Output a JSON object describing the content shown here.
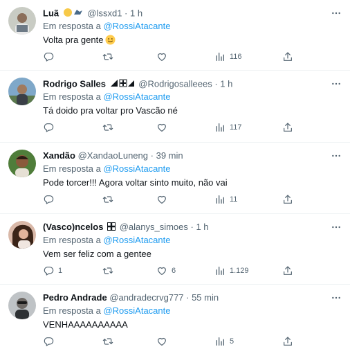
{
  "replies": [
    {
      "name": "Luã",
      "handle": "@lssxd1",
      "separator": "·",
      "time": "1 h",
      "replying_prefix": "Em resposta a",
      "replying_to": "@RossiAtacante",
      "text": "Volta pra gente",
      "reply_count": "",
      "retweet_count": "",
      "like_count": "",
      "view_count": "116"
    },
    {
      "name": "Rodrigo Salles",
      "handle": "@Rodrigosalleees",
      "separator": "·",
      "time": "1 h",
      "replying_prefix": "Em resposta a",
      "replying_to": "@RossiAtacante",
      "text": "Tá doido pra voltar pro Vascão né",
      "reply_count": "",
      "retweet_count": "",
      "like_count": "",
      "view_count": "117"
    },
    {
      "name": "Xandão",
      "handle": "@XandaoLuneng",
      "separator": "·",
      "time": "39 min",
      "replying_prefix": "Em resposta a",
      "replying_to": "@RossiAtacante",
      "text": "Pode torcer!!! Agora voltar sinto muito, não vai",
      "reply_count": "",
      "retweet_count": "",
      "like_count": "",
      "view_count": "11"
    },
    {
      "name": "(Vasco)ncelos",
      "handle": "@alanys_simoes",
      "separator": "·",
      "time": "1 h",
      "replying_prefix": "Em resposta a",
      "replying_to": "@RossiAtacante",
      "text": "Vem ser feliz com a gentee",
      "reply_count": "1",
      "retweet_count": "",
      "like_count": "6",
      "view_count": "1.129"
    },
    {
      "name": "Pedro Andrade",
      "handle": "@andradecrvg777",
      "separator": "·",
      "time": "55 min",
      "replying_prefix": "Em resposta a",
      "replying_to": "@RossiAtacante",
      "text": "VENHAAAAAAAAAA",
      "reply_count": "",
      "retweet_count": "",
      "like_count": "",
      "view_count": "5"
    }
  ],
  "colors": {
    "text": "#0f1419",
    "secondary": "#536471",
    "link": "#1d9bf0",
    "divider": "#eff3f4"
  },
  "icons": [
    "reply-icon",
    "retweet-icon",
    "like-icon",
    "views-icon",
    "share-icon",
    "more-icon"
  ]
}
